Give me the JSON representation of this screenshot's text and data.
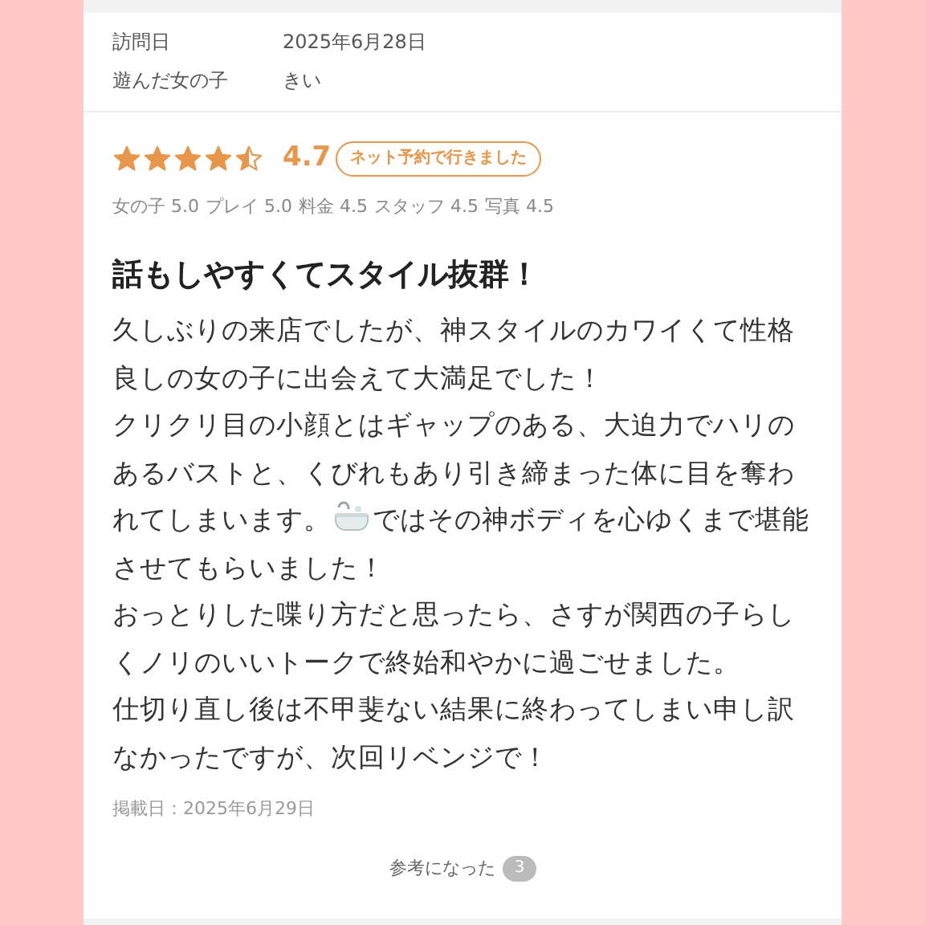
{
  "visit_info": [
    {
      "label": "訪問日",
      "value": "2025年6月28日"
    },
    {
      "label": "遊んだ女の子",
      "value": "きい"
    }
  ],
  "rating": {
    "stars": 4.5,
    "score": "4.7",
    "badge": "ネット予約で行きました"
  },
  "sub_scores": [
    {
      "label": "女の子",
      "value": "5.0"
    },
    {
      "label": "プレイ",
      "value": "5.0"
    },
    {
      "label": "料金",
      "value": "4.5"
    },
    {
      "label": "スタッフ",
      "value": "4.5"
    },
    {
      "label": "写真",
      "value": "4.5"
    }
  ],
  "review": {
    "title": "話もしやすくてスタイル抜群！",
    "paragraphs": [
      [
        {
          "kind": "text",
          "text": "久しぶりの来店でしたが、神スタイルのカワイくて性格良しの女の子に出会えて大満足でした！"
        }
      ],
      [
        {
          "kind": "text",
          "text": "クリクリ目の小顔とはギャップのある、大迫力でハリのあるバストと、くびれもあり引き締まった体に目を奪われてしまいます。"
        },
        {
          "kind": "icon"
        },
        {
          "kind": "text",
          "text": "ではその神ボディを心ゆくまで堪能させてもらいました！"
        }
      ],
      [
        {
          "kind": "text",
          "text": "おっとりした喋り方だと思ったら、さすが関西の子らしくノリのいいトークで終始和やかに過ごせました。"
        }
      ],
      [
        {
          "kind": "text",
          "text": "仕切り直し後は不甲斐ない結果に終わってしまい申し訳なかったですが、次回リベンジで！"
        }
      ]
    ],
    "posted": "掲載日：2025年6月29日"
  },
  "helpful": {
    "label": "参考になった",
    "count": "3"
  }
}
